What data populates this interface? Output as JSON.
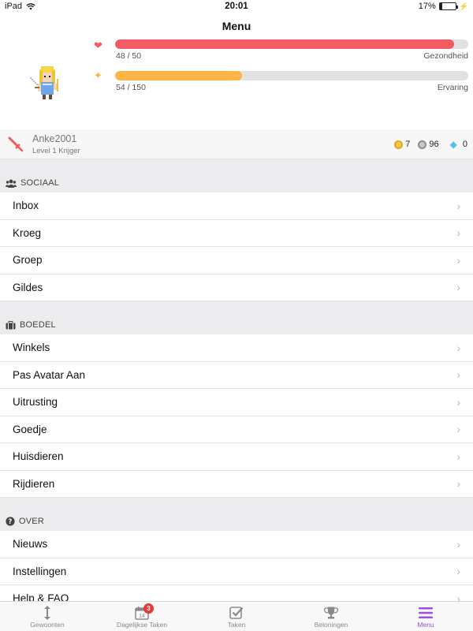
{
  "status": {
    "device": "iPad",
    "time": "20:01",
    "battery": "17%",
    "battery_level": 0.17
  },
  "nav": {
    "title": "Menu"
  },
  "stats": {
    "health": {
      "value": "48 / 50",
      "label": "Gezondheid",
      "fraction": 0.96,
      "color": "#f05c61"
    },
    "experience": {
      "value": "54 / 150",
      "label": "Ervaring",
      "fraction": 0.36,
      "color": "#ffb445"
    }
  },
  "user": {
    "name": "Anke2001",
    "level": "Level 1 Krijger",
    "gold": "7",
    "silver": "96",
    "gems": "0"
  },
  "sections": [
    {
      "title": "SOCIAAL",
      "icon": "users-icon",
      "items": [
        "Inbox",
        "Kroeg",
        "Groep",
        "Gildes"
      ]
    },
    {
      "title": "BOEDEL",
      "icon": "briefcase-icon",
      "items": [
        "Winkels",
        "Pas Avatar Aan",
        "Uitrusting",
        "Goedje",
        "Huisdieren",
        "Rijdieren"
      ]
    },
    {
      "title": "OVER",
      "icon": "question-icon",
      "items": [
        "Nieuws",
        "Instellingen",
        "Help & FAQ"
      ]
    }
  ],
  "tabs": [
    {
      "label": "Gewoonten",
      "icon": "habits-icon"
    },
    {
      "label": "Dagelijkse Taken",
      "icon": "calendar-icon",
      "badge": "3",
      "calendar_day": "14"
    },
    {
      "label": "Taken",
      "icon": "checkbox-icon"
    },
    {
      "label": "Beloningen",
      "icon": "trophy-icon"
    },
    {
      "label": "Menu",
      "icon": "menu-icon",
      "active": true
    }
  ],
  "colors": {
    "accent": "#9b4fe0",
    "health": "#f05c61",
    "experience": "#ffb445"
  }
}
